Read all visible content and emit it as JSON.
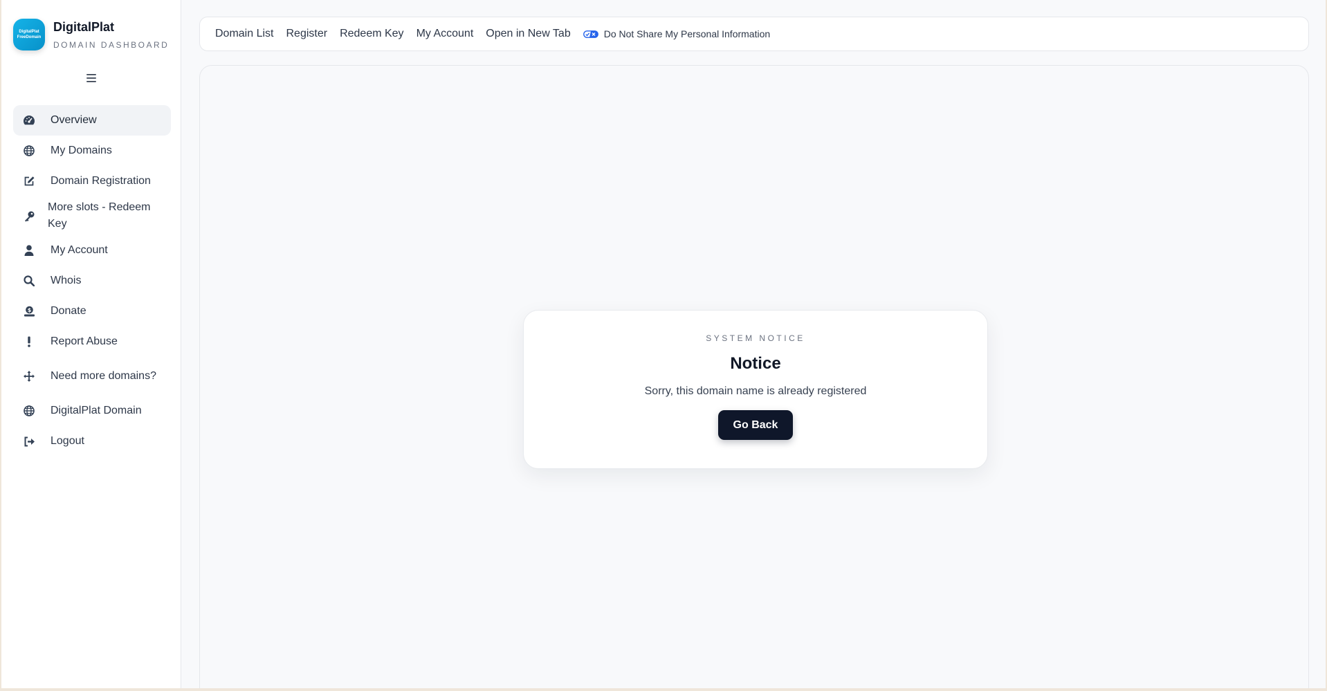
{
  "brand": {
    "logo_line1": "DigitalPlat",
    "logo_line2": "FreeDomain",
    "name": "DigitalPlat",
    "subtitle": "DOMAIN DASHBOARD"
  },
  "sidebar": {
    "items": [
      {
        "label": "Overview",
        "icon": "gauge-icon"
      },
      {
        "label": "My Domains",
        "icon": "globe-icon"
      },
      {
        "label": "Domain Registration",
        "icon": "edit-icon"
      },
      {
        "label": "More slots - Redeem Key",
        "icon": "key-icon"
      },
      {
        "label": "My Account",
        "icon": "user-icon"
      },
      {
        "label": "Whois",
        "icon": "search-icon"
      },
      {
        "label": "Donate",
        "icon": "donate-icon"
      },
      {
        "label": "Report Abuse",
        "icon": "exclamation-icon"
      },
      {
        "label": "Need more domains?",
        "icon": "arrows-icon"
      },
      {
        "label": "DigitalPlat Domain",
        "icon": "globe-icon"
      },
      {
        "label": "Logout",
        "icon": "logout-icon"
      }
    ]
  },
  "topbar": {
    "links": [
      "Domain List",
      "Register",
      "Redeem Key",
      "My Account",
      "Open in New Tab"
    ],
    "privacy_label": "Do Not Share My Personal Information"
  },
  "notice": {
    "eyebrow": "SYSTEM NOTICE",
    "title": "Notice",
    "message": "Sorry, this domain name is already registered",
    "button_label": "Go Back"
  },
  "colors": {
    "accent": "#0f172a",
    "logo": "#15b3e8",
    "privacy_toggle": "#2563eb"
  }
}
